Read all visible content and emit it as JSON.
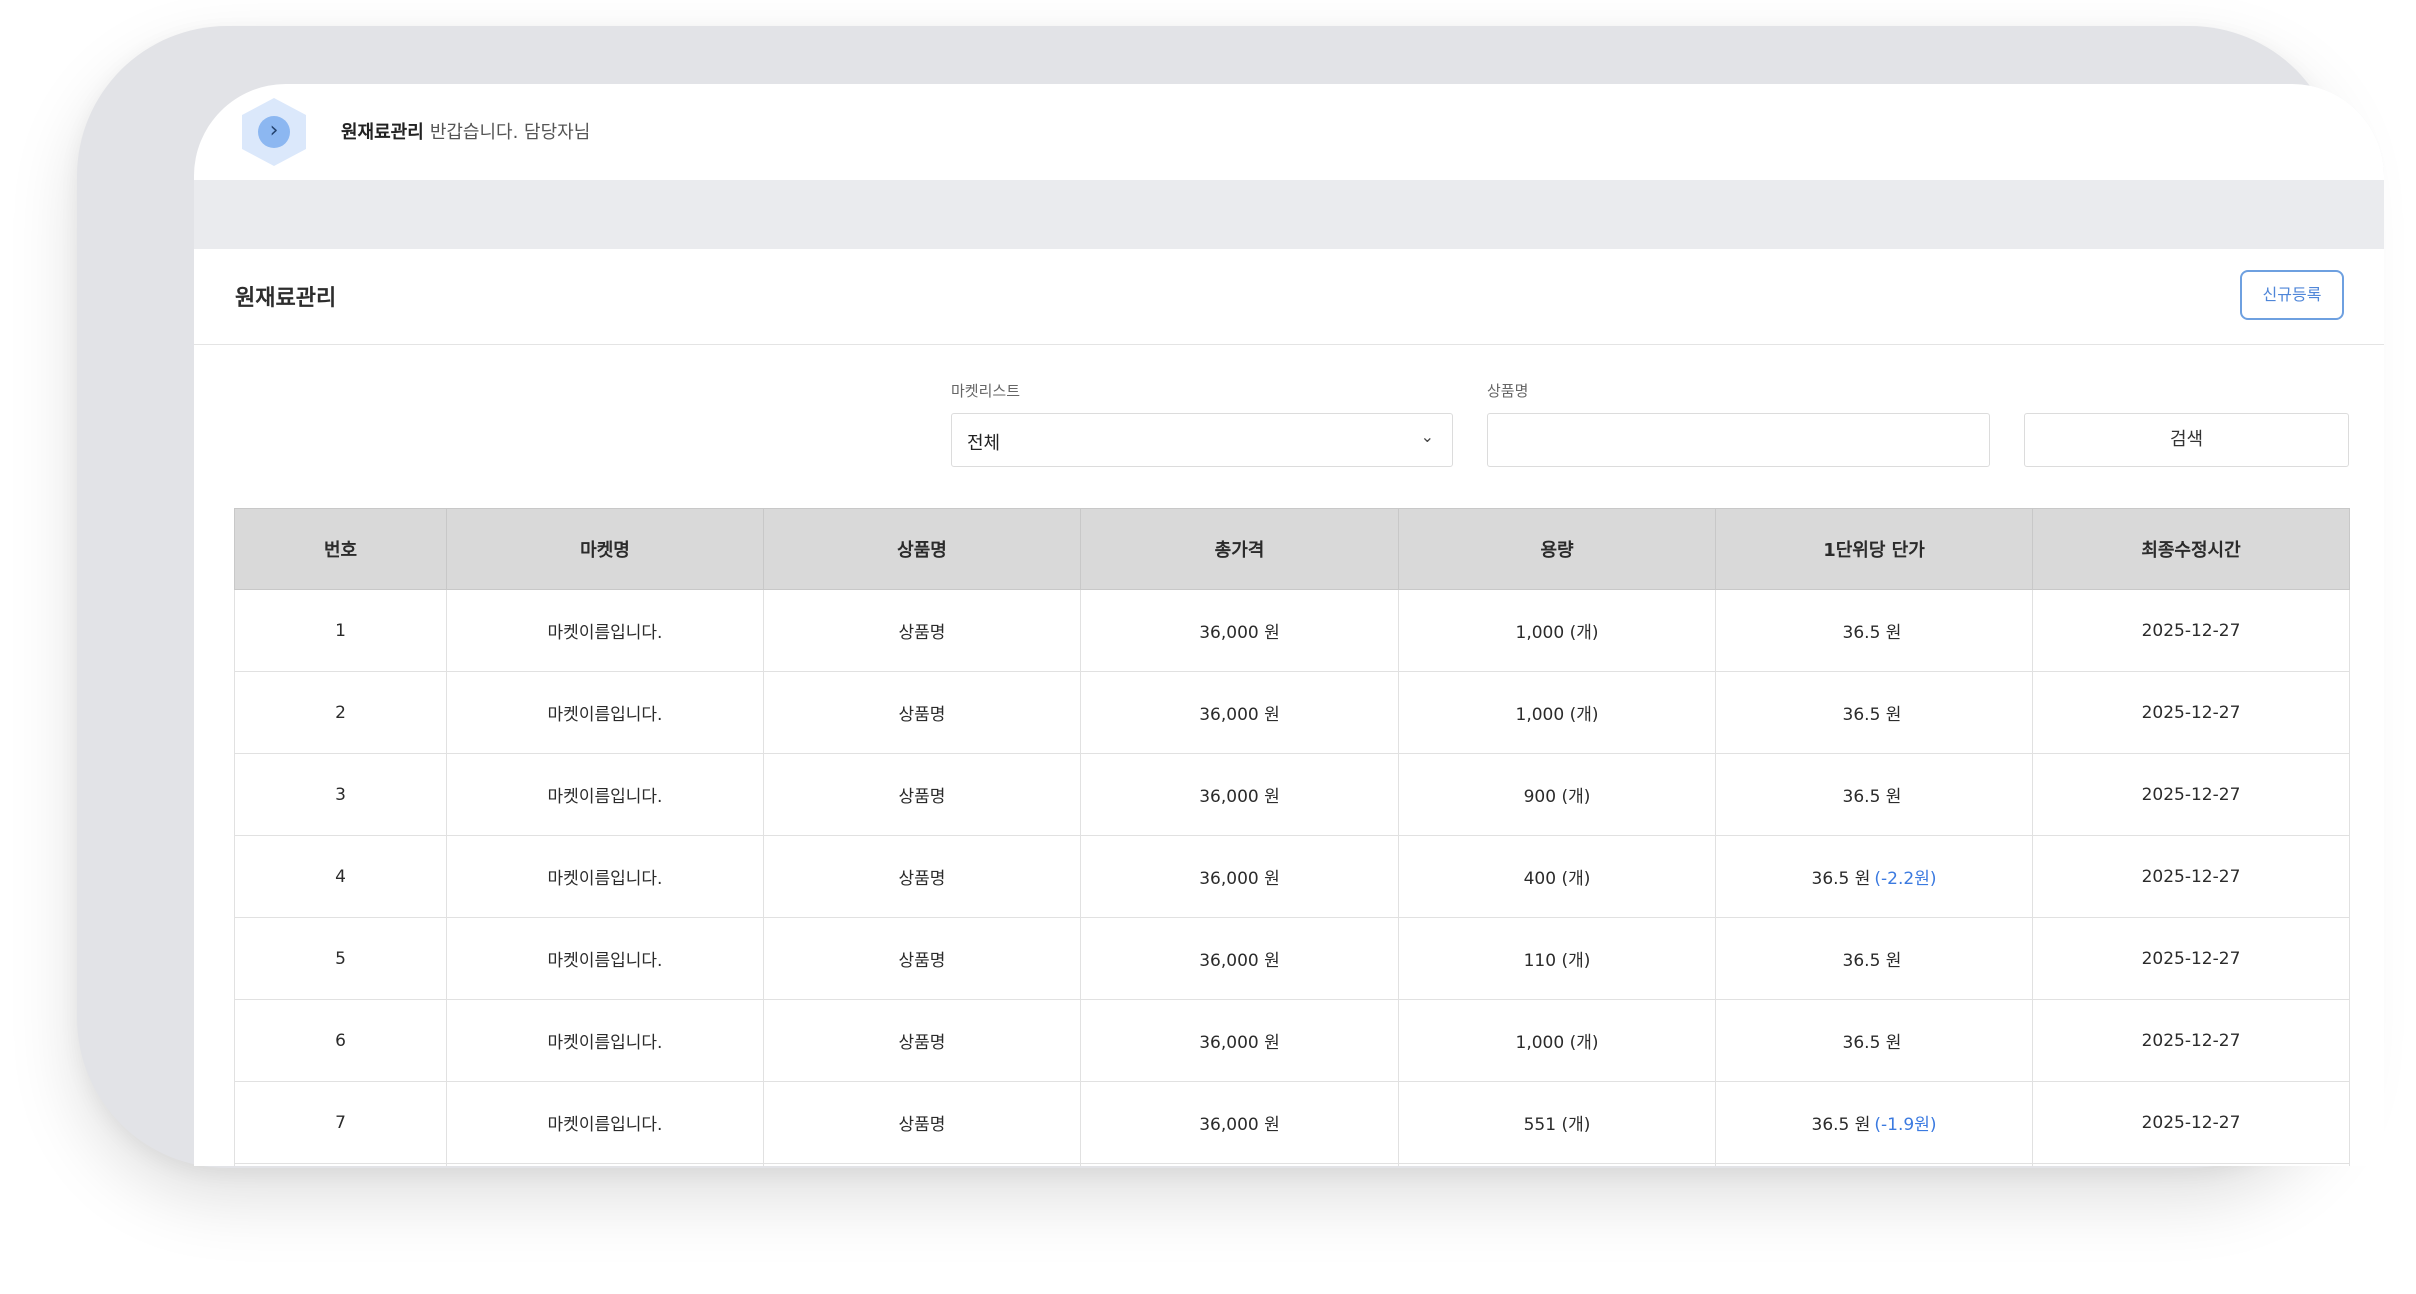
{
  "header": {
    "title": "원재료관리",
    "greeting": "반갑습니다. 담당자님"
  },
  "panel": {
    "title": "원재료관리",
    "new_button": "신규등록"
  },
  "filters": {
    "market_label": "마켓리스트",
    "market_value": "전체",
    "product_label": "상품명",
    "product_value": "",
    "product_placeholder": "",
    "search_button": "검색"
  },
  "table": {
    "columns": [
      "번호",
      "마켓명",
      "상품명",
      "총가격",
      "용량",
      "1단위당 단가",
      "최종수정시간"
    ],
    "rows": [
      {
        "no": "1",
        "market": "마켓이름입니다.",
        "product": "상품명",
        "total": "36,000 원",
        "qty": "1,000 (개)",
        "unit": "36.5 원",
        "diff": "",
        "updated": "2025-12-27"
      },
      {
        "no": "2",
        "market": "마켓이름입니다.",
        "product": "상품명",
        "total": "36,000 원",
        "qty": "1,000 (개)",
        "unit": "36.5 원",
        "diff": "",
        "updated": "2025-12-27"
      },
      {
        "no": "3",
        "market": "마켓이름입니다.",
        "product": "상품명",
        "total": "36,000 원",
        "qty": "900 (개)",
        "unit": "36.5 원",
        "diff": "",
        "updated": "2025-12-27"
      },
      {
        "no": "4",
        "market": "마켓이름입니다.",
        "product": "상품명",
        "total": "36,000 원",
        "qty": "400 (개)",
        "unit": "36.5 원",
        "diff": "(-2.2원)",
        "updated": "2025-12-27"
      },
      {
        "no": "5",
        "market": "마켓이름입니다.",
        "product": "상품명",
        "total": "36,000 원",
        "qty": "110 (개)",
        "unit": "36.5 원",
        "diff": "",
        "updated": "2025-12-27"
      },
      {
        "no": "6",
        "market": "마켓이름입니다.",
        "product": "상품명",
        "total": "36,000 원",
        "qty": "1,000 (개)",
        "unit": "36.5 원",
        "diff": "",
        "updated": "2025-12-27"
      },
      {
        "no": "7",
        "market": "마켓이름입니다.",
        "product": "상품명",
        "total": "36,000 원",
        "qty": "551 (개)",
        "unit": "36.5 원",
        "diff": "(-1.9원)",
        "updated": "2025-12-27"
      },
      {
        "no": "",
        "market": "",
        "product": "",
        "total": "",
        "qty": "",
        "unit": "",
        "diff": "",
        "updated": ""
      }
    ]
  },
  "colors": {
    "accent": "#4f86d8",
    "diff_text": "#3b7ae0",
    "header_bg": "#d9d9d9",
    "frame": "#e2e3e7"
  },
  "icons": {
    "logo": "chevron-right-icon",
    "select": "chevron-down-icon"
  }
}
